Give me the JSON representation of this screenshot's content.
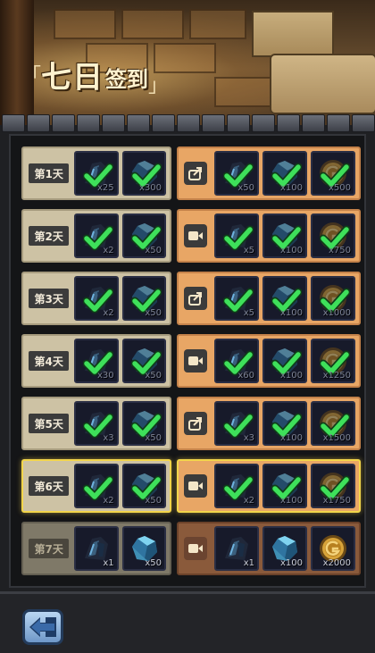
{
  "header": {
    "title_main": "七日",
    "title_sub": "签到",
    "bracket_open": "「",
    "bracket_close": "」"
  },
  "rows": [
    {
      "day": "第1天",
      "state": "claimed",
      "paid_type": "share-icon",
      "free": [
        {
          "icon": "shard-icon",
          "qty": "x25"
        },
        {
          "icon": "crystal-icon",
          "qty": "x300"
        }
      ],
      "paid": [
        {
          "icon": "shard-icon",
          "qty": "x50"
        },
        {
          "icon": "crystal-icon",
          "qty": "x100"
        },
        {
          "icon": "coin-icon",
          "qty": "x500"
        }
      ]
    },
    {
      "day": "第2天",
      "state": "claimed",
      "paid_type": "video-icon",
      "free": [
        {
          "icon": "shard-icon",
          "qty": "x2"
        },
        {
          "icon": "crystal-icon",
          "qty": "x50"
        }
      ],
      "paid": [
        {
          "icon": "shard-icon",
          "qty": "x5"
        },
        {
          "icon": "crystal-icon",
          "qty": "x100"
        },
        {
          "icon": "coin-icon",
          "qty": "x750"
        }
      ]
    },
    {
      "day": "第3天",
      "state": "claimed",
      "paid_type": "share-icon",
      "free": [
        {
          "icon": "shard-icon",
          "qty": "x2"
        },
        {
          "icon": "crystal-icon",
          "qty": "x50"
        }
      ],
      "paid": [
        {
          "icon": "shard-icon",
          "qty": "x5"
        },
        {
          "icon": "crystal-icon",
          "qty": "x100"
        },
        {
          "icon": "coin-icon",
          "qty": "x1000"
        }
      ]
    },
    {
      "day": "第4天",
      "state": "claimed",
      "paid_type": "video-icon",
      "free": [
        {
          "icon": "shard-icon",
          "qty": "x30"
        },
        {
          "icon": "crystal-icon",
          "qty": "x50"
        }
      ],
      "paid": [
        {
          "icon": "shard-icon",
          "qty": "x60"
        },
        {
          "icon": "crystal-icon",
          "qty": "x100"
        },
        {
          "icon": "coin-icon",
          "qty": "x1250"
        }
      ]
    },
    {
      "day": "第5天",
      "state": "claimed",
      "paid_type": "share-icon",
      "free": [
        {
          "icon": "shard-icon",
          "qty": "x3"
        },
        {
          "icon": "crystal-icon",
          "qty": "x50"
        }
      ],
      "paid": [
        {
          "icon": "shard-icon",
          "qty": "x3"
        },
        {
          "icon": "crystal-icon",
          "qty": "x100"
        },
        {
          "icon": "coin-icon",
          "qty": "x1500"
        }
      ]
    },
    {
      "day": "第6天",
      "state": "claimed-selected",
      "paid_type": "video-icon",
      "free": [
        {
          "icon": "shard-icon",
          "qty": "x2"
        },
        {
          "icon": "crystal-icon",
          "qty": "x50"
        }
      ],
      "paid": [
        {
          "icon": "shard-icon",
          "qty": "x2"
        },
        {
          "icon": "crystal-icon",
          "qty": "x100"
        },
        {
          "icon": "coin-icon",
          "qty": "x1750"
        }
      ]
    },
    {
      "day": "第7天",
      "state": "locked",
      "paid_type": "video-icon",
      "free": [
        {
          "icon": "shard-icon",
          "qty": "x1"
        },
        {
          "icon": "crystal-icon",
          "qty": "x50"
        }
      ],
      "paid": [
        {
          "icon": "shard-icon",
          "qty": "x1"
        },
        {
          "icon": "crystal-icon",
          "qty": "x100"
        },
        {
          "icon": "coin-icon",
          "qty": "x2000"
        }
      ]
    }
  ],
  "footer": {
    "back_icon": "back-arrow-icon"
  },
  "colors": {
    "free_bg": "#cdc2a4",
    "paid_bg": "#e8a665",
    "selected_border": "#f2d54a",
    "check": "#3ee05a"
  }
}
